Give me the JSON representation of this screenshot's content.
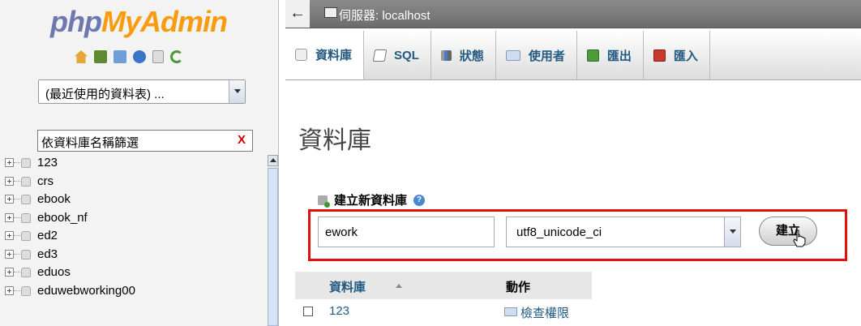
{
  "nav": {
    "logo_part1": "php",
    "logo_part2": "MyAdmin",
    "recent_tables": "(最近使用的資料表) ...",
    "filter": {
      "value": "依資料庫名稱篩選",
      "clear": "X"
    },
    "databases": [
      "123",
      "crs",
      "ebook",
      "ebook_nf",
      "ed2",
      "ed3",
      "eduos",
      "eduwebworking00"
    ]
  },
  "topbar": {
    "back": "←",
    "server_label": "伺服器: localhost"
  },
  "tabs": [
    {
      "label": "資料庫",
      "icon": "database-icon"
    },
    {
      "label": "SQL",
      "icon": "sql-icon"
    },
    {
      "label": "狀態",
      "icon": "status-icon"
    },
    {
      "label": "使用者",
      "icon": "users-icon"
    },
    {
      "label": "匯出",
      "icon": "export-icon"
    },
    {
      "label": "匯入",
      "icon": "import-icon"
    }
  ],
  "main": {
    "heading": "資料庫",
    "create_label": "建立新資料庫",
    "help": "?",
    "db_name_value": "ework",
    "collation_value": "utf8_unicode_ci",
    "create_button": "建立",
    "table": {
      "col_db": "資料庫",
      "col_action": "動作",
      "rows": [
        {
          "db": "123",
          "action": "檢查權限"
        }
      ]
    }
  },
  "colors": {
    "highlight_box": "#e01010",
    "link": "#235a81",
    "logo_php": "#6c78af",
    "logo_myadmin": "#f89c0e"
  }
}
